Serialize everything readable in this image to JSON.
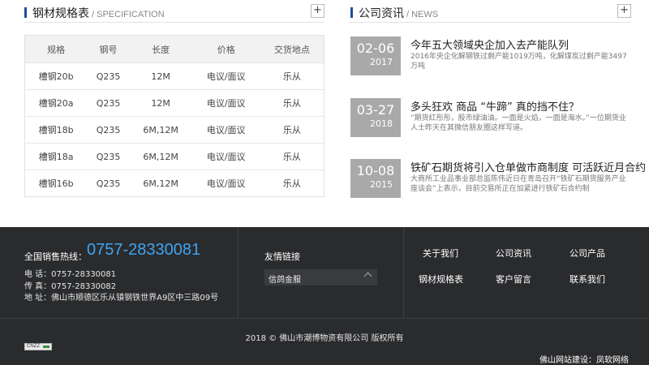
{
  "spec": {
    "title": "钢材规格表",
    "subtitle": "/ SPECIFICATION",
    "more": "+",
    "headers": [
      "规格",
      "钢号",
      "长度",
      "价格",
      "交货地点"
    ],
    "rows": [
      [
        "槽钢20b",
        "Q235",
        "12M",
        "电议/面议",
        "乐从"
      ],
      [
        "槽钢20a",
        "Q235",
        "12M",
        "电议/面议",
        "乐从"
      ],
      [
        "槽钢18b",
        "Q235",
        "6M,12M",
        "电议/面议",
        "乐从"
      ],
      [
        "槽钢18a",
        "Q235",
        "6M,12M",
        "电议/面议",
        "乐从"
      ],
      [
        "槽钢16b",
        "Q235",
        "6M,12M",
        "电议/面议",
        "乐从"
      ]
    ]
  },
  "news": {
    "title": "公司资讯",
    "subtitle": "/ NEWS",
    "more": "+",
    "items": [
      {
        "date": "02-06",
        "year": "2017",
        "title": "今年五大领域央企加入去产能队列",
        "desc": "2016年央企化解钢铁过剩产能1019万吨，化解煤炭过剩产能3497万吨"
      },
      {
        "date": "03-27",
        "year": "2018",
        "title": "多头狂欢 商品 “牛蹄” 真的挡不住？",
        "desc": "“期货红彤彤，股市绿油油。一面是火焰，一面是海水。”一位期货业人士昨天在其微信朋友圈这样写道。"
      },
      {
        "date": "10-08",
        "year": "2015",
        "title": "铁矿石期货将引入仓单做市商制度 可活跃近月合约",
        "desc": "大商所工业品事业部总监陈伟近日在青岛召开“铁矿石期货服务产业座谈会”上表示，目前交易所正在加紧进行铁矿石合约制"
      }
    ]
  },
  "footer": {
    "hotline_label": "全国销售热线：",
    "hotline_number": "0757-28330081",
    "phone": "电   话：0757-28330081",
    "fax": "传   真：0757-28330082",
    "address": "地   址：佛山市顺德区乐从镇钢铁世界A9区中三路09号",
    "links_title": "友情链接",
    "links_selected": "信鸽金服",
    "nav": [
      "关于我们",
      "公司资讯",
      "公司产品",
      "钢材规格表",
      "客户留言",
      "联系我们"
    ],
    "copyright": "2018 ©  佛山市潮博物资有限公司  版权所有",
    "cnzz": "CNZZ",
    "credit": "佛山网站建设：凤软网络"
  }
}
